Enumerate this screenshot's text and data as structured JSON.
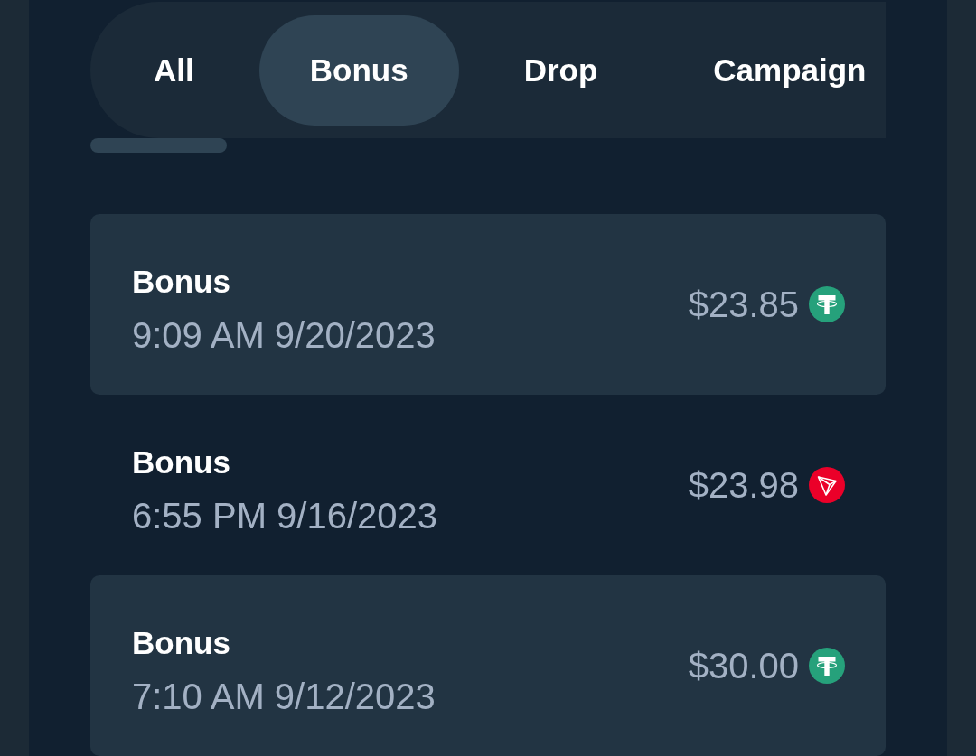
{
  "tabs": [
    {
      "label": "All",
      "selected": false
    },
    {
      "label": "Bonus",
      "selected": true
    },
    {
      "label": "Drop",
      "selected": false
    },
    {
      "label": "Campaign",
      "selected": false
    }
  ],
  "transactions": [
    {
      "title": "Bonus",
      "time": "9:09 AM 9/20/2023",
      "amount": "$23.85",
      "kind": "tether"
    },
    {
      "title": "Bonus",
      "time": "6:55 PM 9/16/2023",
      "amount": "$23.98",
      "kind": "tron"
    },
    {
      "title": "Bonus",
      "time": "7:10 AM 9/12/2023",
      "amount": "$30.00",
      "kind": "tether"
    }
  ]
}
